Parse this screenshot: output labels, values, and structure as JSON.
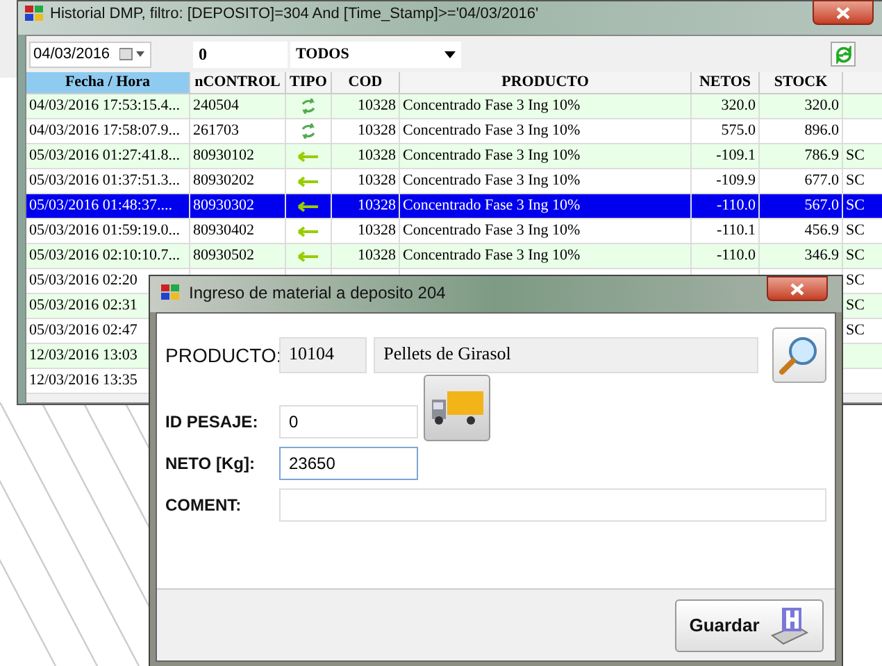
{
  "main_window": {
    "title": "Historial DMP, filtro: [DEPOSITO]=304 And [Time_Stamp]>='04/03/2016'",
    "toolbar": {
      "date": "04/03/2016",
      "number": "0",
      "filter": "TODOS"
    },
    "table": {
      "columns": [
        {
          "label": "Fecha / Hora",
          "sorted": true
        },
        {
          "label": "nCONTROL",
          "sorted": false
        },
        {
          "label": "TIPO",
          "sorted": false
        },
        {
          "label": "COD",
          "sorted": false
        },
        {
          "label": "PRODUCTO",
          "sorted": false
        },
        {
          "label": "NETOS",
          "sorted": false
        },
        {
          "label": "STOCK",
          "sorted": false
        }
      ],
      "rows": [
        {
          "fecha": "04/03/2016 17:53:15.4...",
          "ncontrol": "240504",
          "kind": "transfer",
          "cod": "10328",
          "producto": "Concentrado Fase 3 Ing 10%",
          "netos": "320.0",
          "stock": "320.0",
          "selected": false
        },
        {
          "fecha": "04/03/2016 17:58:07.9...",
          "ncontrol": "261703",
          "kind": "transfer",
          "cod": "10328",
          "producto": "Concentrado Fase 3 Ing 10%",
          "netos": "575.0",
          "stock": "896.0",
          "selected": false
        },
        {
          "fecha": "05/03/2016 01:27:41.8...",
          "ncontrol": "80930102",
          "kind": "out",
          "cod": "10328",
          "producto": "Concentrado Fase 3 Ing 10%",
          "netos": "-109.1",
          "stock": "786.9",
          "column_8": "SC",
          "selected": false
        },
        {
          "fecha": "05/03/2016 01:37:51.3...",
          "ncontrol": "80930202",
          "kind": "out",
          "cod": "10328",
          "producto": "Concentrado Fase 3 Ing 10%",
          "netos": "-109.9",
          "stock": "677.0",
          "column_8": "SC",
          "selected": false
        },
        {
          "fecha": "05/03/2016 01:48:37....",
          "ncontrol": "80930302",
          "kind": "out",
          "cod": "10328",
          "producto": "Concentrado Fase 3 Ing 10%",
          "netos": "-110.0",
          "stock": "567.0",
          "column_8": "SC",
          "selected": true
        },
        {
          "fecha": "05/03/2016 01:59:19.0...",
          "ncontrol": "80930402",
          "kind": "out",
          "cod": "10328",
          "producto": "Concentrado Fase 3 Ing 10%",
          "netos": "-110.1",
          "stock": "456.9",
          "column_8": "SC",
          "selected": false
        },
        {
          "fecha": "05/03/2016 02:10:10.7...",
          "ncontrol": "80930502",
          "kind": "out",
          "cod": "10328",
          "producto": "Concentrado Fase 3 Ing 10%",
          "netos": "-110.0",
          "stock": "346.9",
          "column_8": "SC",
          "selected": false
        },
        {
          "fecha": "05/03/2016 02:20",
          "column_8": "SC",
          "selected": false
        },
        {
          "fecha": "05/03/2016 02:31",
          "column_8": "SC",
          "selected": false
        },
        {
          "fecha": "05/03/2016 02:47",
          "column_8": "SC",
          "selected": false
        },
        {
          "fecha": "12/03/2016 13:03",
          "selected": false
        },
        {
          "fecha": "12/03/2016 13:35",
          "selected": false
        }
      ]
    }
  },
  "dialog": {
    "title": "Ingreso de material a deposito 204",
    "producto_label": "PRODUCTO:",
    "producto_code": "10104",
    "producto_name": "Pellets de Girasol",
    "fields": [
      {
        "label": "ID PESAJE:",
        "value": "0",
        "focused": false
      },
      {
        "label": "NETO [Kg]:",
        "value": "23650",
        "focused": true
      }
    ],
    "coment_label": "COMENT:",
    "save_button": "Guardar"
  }
}
